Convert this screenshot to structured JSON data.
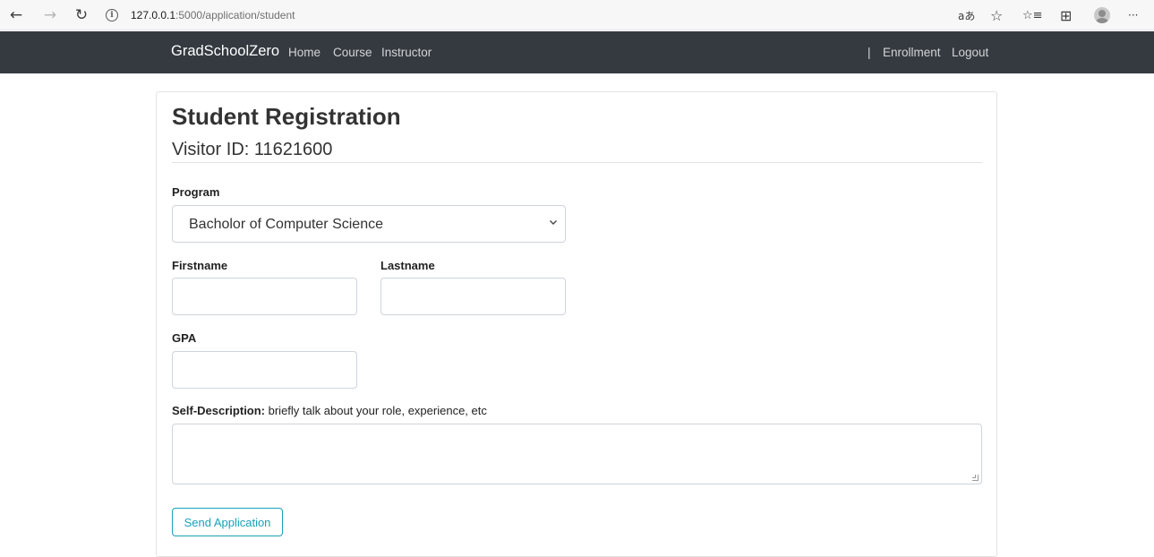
{
  "browser": {
    "url_host": "127.0.0.1",
    "url_rest": ":5000/application/student",
    "back_glyph": "←",
    "forward_glyph": "→",
    "reload_glyph": "↻",
    "info_glyph": "i",
    "read_aloud_glyph": "aあ",
    "favorite_glyph": "☆",
    "favorites_bar_glyph": "☆≡",
    "collections_glyph": "⊞",
    "more_glyph": "···"
  },
  "navbar": {
    "brand": "GradSchoolZero",
    "links": [
      "Home",
      "Course",
      "Instructor"
    ],
    "separator": "|",
    "right_links": [
      "Enrollment",
      "Logout"
    ]
  },
  "form": {
    "title": "Student Registration",
    "visitor_id": "Visitor ID: 11621600",
    "program_label": "Program",
    "program_value": "Bacholor of Computer Science",
    "firstname_label": "Firstname",
    "lastname_label": "Lastname",
    "gpa_label": "GPA",
    "desc_label_bold": "Self-Description:",
    "desc_label_rest": " briefly talk about your role, experience, etc",
    "submit_label": "Send Application"
  },
  "colors": {
    "navbar_bg": "#343a40",
    "accent": "#17a2b8"
  }
}
